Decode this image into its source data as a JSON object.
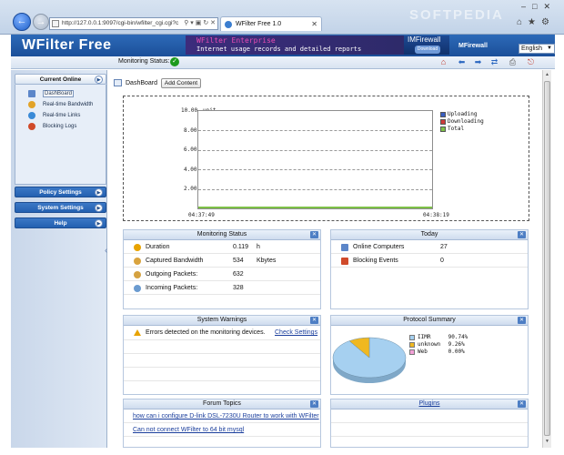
{
  "browser": {
    "address": "http://127.0.0.1:9097/cgi-bin/wfilter_cgi.cgi?c",
    "tab_title": "WFilter Free 1.0",
    "watermark": "SOFTPEDIA"
  },
  "header": {
    "title": "WFilter Free",
    "banner_line1": "WFilter Enterprise",
    "banner_line2": "Internet usage records and detailed reports",
    "banner_product": "IMFirewall",
    "banner_download": "Download",
    "banner_product2": "MFirewall",
    "language": "English"
  },
  "statusbar": {
    "label": "Monitoring Status:"
  },
  "sidebar": {
    "current_online": {
      "title": "Current Online",
      "items": [
        {
          "label": "DashBoard",
          "color": "#5c86c9"
        },
        {
          "label": "Real-time Bandwidth",
          "color": "#e2a329"
        },
        {
          "label": "Real-time Links",
          "color": "#3a8ad7"
        },
        {
          "label": "Blocking Logs",
          "color": "#d04a2a"
        }
      ]
    },
    "policy": {
      "title": "Policy Settings"
    },
    "system": {
      "title": "System Settings"
    },
    "help": {
      "title": "Help"
    }
  },
  "main": {
    "dashboard_label": "DashBoard",
    "add_content": "Add Content"
  },
  "chart_data": {
    "type": "line",
    "y_unit": "unit",
    "yticks": [
      "10.00",
      "8.00",
      "6.00",
      "4.00",
      "2.00"
    ],
    "ylim": [
      0,
      10
    ],
    "x": [
      "04:37:49",
      "04:38:19"
    ],
    "series": [
      {
        "name": "Uploading",
        "color": "#3a5fc2",
        "values": [
          0,
          0
        ]
      },
      {
        "name": "Downloading",
        "color": "#d03a3a",
        "values": [
          0,
          0
        ]
      },
      {
        "name": "Total",
        "color": "#7ec147",
        "values": [
          0,
          0
        ]
      }
    ],
    "grid": true,
    "legend": "right"
  },
  "monitoring_status": {
    "title": "Monitoring Status",
    "rows": [
      {
        "label": "Duration",
        "value": "0.119",
        "unit": "h",
        "color": "#e8a300"
      },
      {
        "label": "Captured Bandwidth",
        "value": "534",
        "unit": "Kbytes",
        "color": "#d9a33d"
      },
      {
        "label": "Outgoing Packets:",
        "value": "632",
        "unit": "",
        "color": "#d5a240"
      },
      {
        "label": "Incoming Packets:",
        "value": "328",
        "unit": "",
        "color": "#6b9bd0"
      }
    ]
  },
  "today": {
    "title": "Today",
    "rows": [
      {
        "label": "Online Computers",
        "value": "27",
        "color": "#5c86c9"
      },
      {
        "label": "Blocking Events",
        "value": "0",
        "color": "#d04a2a"
      }
    ]
  },
  "system_warnings": {
    "title": "System Warnings",
    "message": "Errors detected on the monitoring devices.",
    "link": "Check Settings"
  },
  "protocol_summary": {
    "title": "Protocol Summary",
    "chart_data": {
      "type": "pie",
      "slices": [
        {
          "name": "IIMR",
          "value": 90.74,
          "label": "90.74%",
          "color": "#a6d0f0"
        },
        {
          "name": "unknown",
          "value": 9.26,
          "label": "9.26%",
          "color": "#f0b820"
        },
        {
          "name": "Web",
          "value": 0.0,
          "label": "0.00%",
          "color": "#f2a0d6"
        }
      ]
    }
  },
  "forum_topics": {
    "title": "Forum Topics",
    "links": [
      "how can i configure D-link DSL-7230U Router to work with WFilter",
      "Can not connect WFilter to 64 bit mysql"
    ]
  },
  "plugins": {
    "title": "Plugins"
  }
}
